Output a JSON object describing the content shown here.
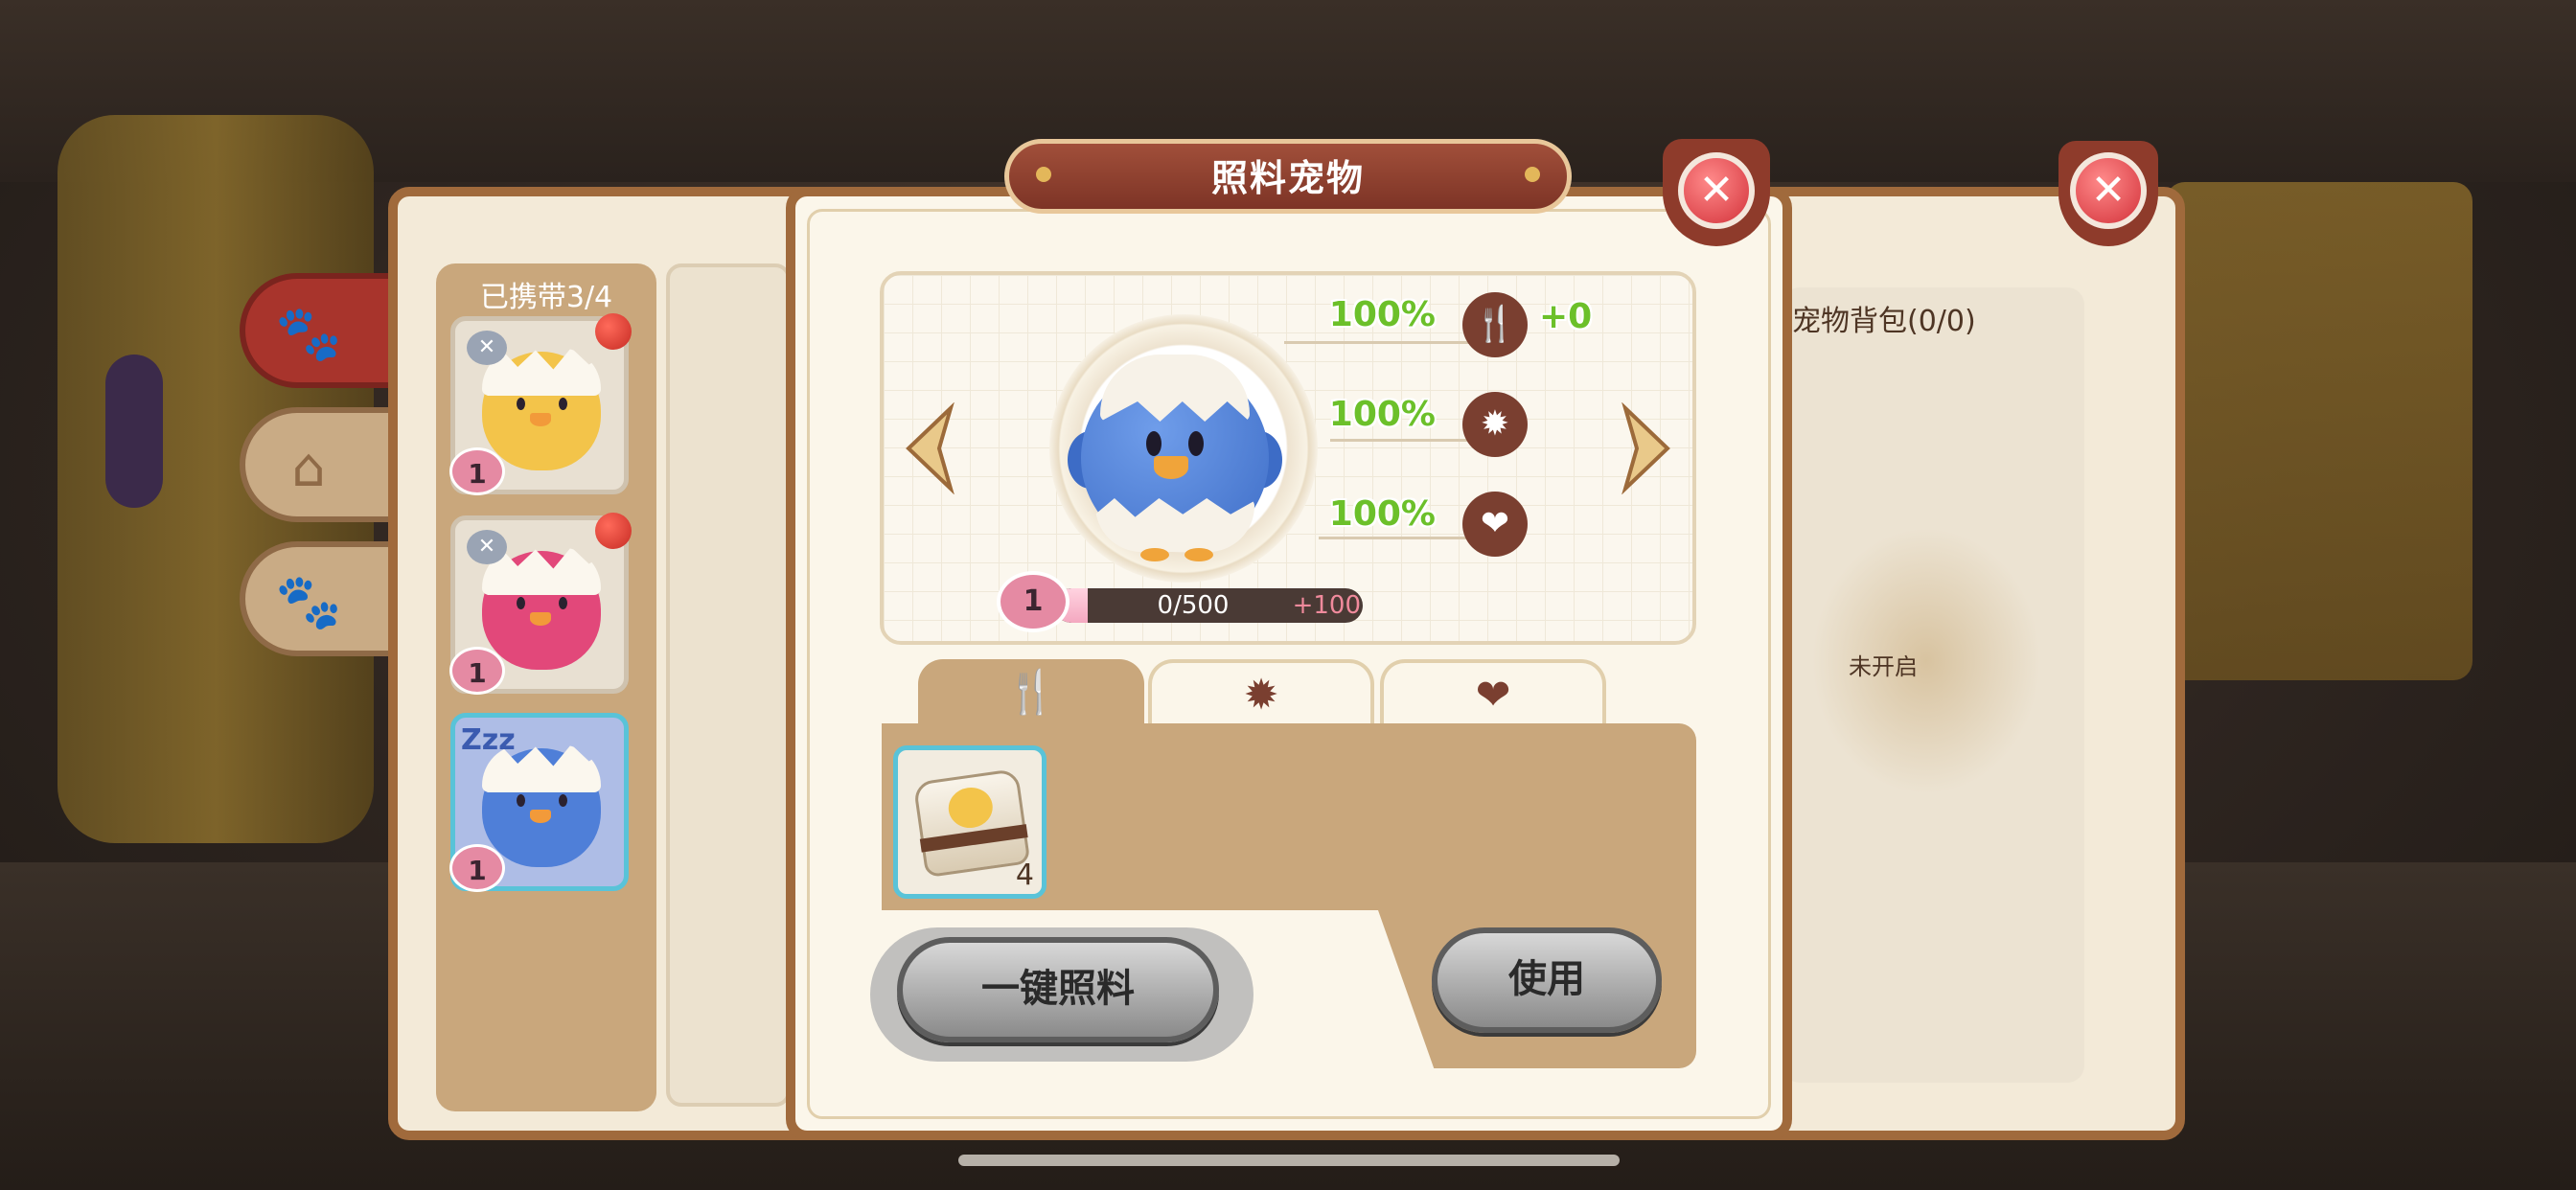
{
  "dialog": {
    "title": "照料宠物",
    "close_icon": "close-icon"
  },
  "pet_list": {
    "title": "已携带3/4",
    "pets": [
      {
        "name": "yellow-chick",
        "level": "1",
        "color": "#f3c44a",
        "status": "angry"
      },
      {
        "name": "pink-chick",
        "level": "1",
        "color": "#e2487a",
        "status": "angry"
      },
      {
        "name": "blue-chick",
        "level": "1",
        "color": "#4f7fd8",
        "status": "sleeping",
        "status_text": "Zzz"
      }
    ]
  },
  "side_tabs": [
    {
      "icon": "paw-icon",
      "glyph": "🐾",
      "active": true
    },
    {
      "icon": "house-paw-icon",
      "glyph": "⌂",
      "active": false
    },
    {
      "icon": "paw-badge-icon",
      "glyph": "🐾",
      "active": false
    }
  ],
  "pet_bag": {
    "title": "宠物背包(0/0)",
    "empty_text": "未开启"
  },
  "current_pet": {
    "level": "1",
    "exp_text": "0/500",
    "exp_fraction": 0.11,
    "exp_gain": "+100"
  },
  "stats": [
    {
      "icon": "fork-spoon-icon",
      "glyph": "🍴",
      "value": "100%",
      "delta": "+0"
    },
    {
      "icon": "sun-icon",
      "glyph": "✹",
      "value": "100%"
    },
    {
      "icon": "heart-icon",
      "glyph": "❤",
      "value": "100%"
    }
  ],
  "tabs": [
    {
      "icon": "fork-spoon-icon",
      "glyph": "🍴",
      "active": true,
      "color": "#f2b81e"
    },
    {
      "icon": "sun-icon",
      "glyph": "✹",
      "active": false,
      "color": "#7a3f30"
    },
    {
      "icon": "heart-icon",
      "glyph": "❤",
      "active": false,
      "color": "#7a3f30"
    }
  ],
  "items": [
    {
      "name": "pet-food-bag",
      "count": "4"
    }
  ],
  "buttons": {
    "feed_all": "一键照料",
    "use": "使用"
  },
  "colors": {
    "frame_brown": "#a06a3c",
    "title_red": "#8e3b2b",
    "stat_green": "#6cc02a",
    "selected_cyan": "#59c3d8"
  }
}
